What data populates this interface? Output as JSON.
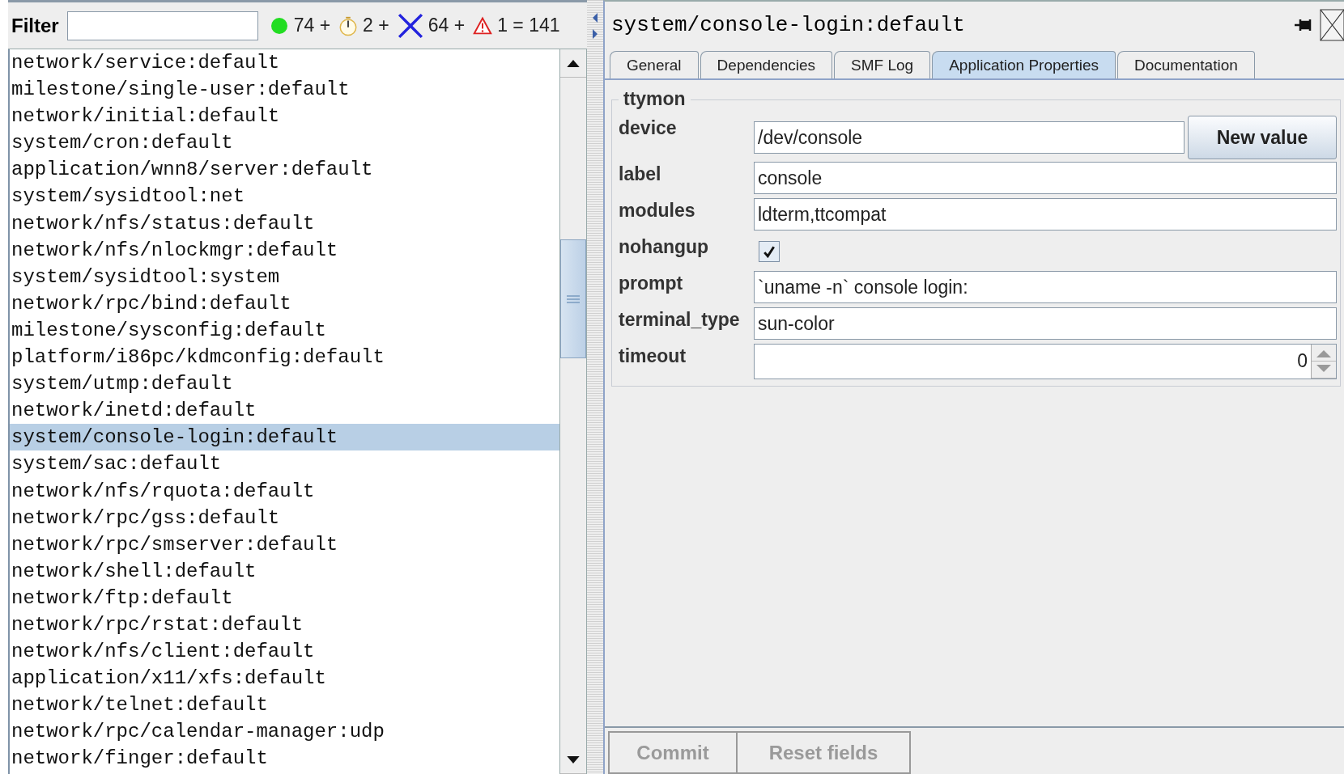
{
  "filter": {
    "label": "Filter"
  },
  "status": [
    {
      "kind": "online",
      "text": "74 +"
    },
    {
      "kind": "pending",
      "text": "2 +"
    },
    {
      "kind": "offline",
      "text": "64 +"
    },
    {
      "kind": "maintenance",
      "text": "1 = 141"
    }
  ],
  "services": [
    {
      "name": "network/service:default",
      "selected": false
    },
    {
      "name": "milestone/single-user:default",
      "selected": false
    },
    {
      "name": "network/initial:default",
      "selected": false
    },
    {
      "name": "system/cron:default",
      "selected": false
    },
    {
      "name": "application/wnn8/server:default",
      "selected": false
    },
    {
      "name": "system/sysidtool:net",
      "selected": false
    },
    {
      "name": "network/nfs/status:default",
      "selected": false
    },
    {
      "name": "network/nfs/nlockmgr:default",
      "selected": false
    },
    {
      "name": "system/sysidtool:system",
      "selected": false
    },
    {
      "name": "network/rpc/bind:default",
      "selected": false
    },
    {
      "name": "milestone/sysconfig:default",
      "selected": false
    },
    {
      "name": "platform/i86pc/kdmconfig:default",
      "selected": false
    },
    {
      "name": "system/utmp:default",
      "selected": false
    },
    {
      "name": "network/inetd:default",
      "selected": false
    },
    {
      "name": "system/console-login:default",
      "selected": true
    },
    {
      "name": "system/sac:default",
      "selected": false
    },
    {
      "name": "network/nfs/rquota:default",
      "selected": false
    },
    {
      "name": "network/rpc/gss:default",
      "selected": false
    },
    {
      "name": "network/rpc/smserver:default",
      "selected": false
    },
    {
      "name": "network/shell:default",
      "selected": false
    },
    {
      "name": "network/ftp:default",
      "selected": false
    },
    {
      "name": "network/rpc/rstat:default",
      "selected": false
    },
    {
      "name": "network/nfs/client:default",
      "selected": false
    },
    {
      "name": "application/x11/xfs:default",
      "selected": false
    },
    {
      "name": "network/telnet:default",
      "selected": false
    },
    {
      "name": "network/rpc/calendar-manager:udp",
      "selected": false
    },
    {
      "name": "network/finger:default",
      "selected": false
    }
  ],
  "detail": {
    "title": "system/console-login:default",
    "tabs": [
      {
        "label": "General",
        "selected": false
      },
      {
        "label": "Dependencies",
        "selected": false
      },
      {
        "label": "SMF Log",
        "selected": false
      },
      {
        "label": "Application Properties",
        "selected": true
      },
      {
        "label": "Documentation",
        "selected": false
      }
    ],
    "group": "ttymon",
    "properties": [
      {
        "kind": "text",
        "label": "device",
        "value": "/dev/console",
        "button": "New value"
      },
      {
        "kind": "text",
        "label": "label",
        "value": "console"
      },
      {
        "kind": "text",
        "label": "modules",
        "value": "ldterm,ttcompat"
      },
      {
        "kind": "checkbox",
        "label": "nohangup",
        "checked": true
      },
      {
        "kind": "text",
        "label": "prompt",
        "value": "`uname -n` console login:"
      },
      {
        "kind": "text",
        "label": "terminal_type",
        "value": "sun-color"
      },
      {
        "kind": "spinner",
        "label": "timeout",
        "value": "0"
      }
    ],
    "buttons": [
      {
        "label": "Commit",
        "disabled": true
      },
      {
        "label": "Reset fields",
        "disabled": true
      }
    ]
  }
}
